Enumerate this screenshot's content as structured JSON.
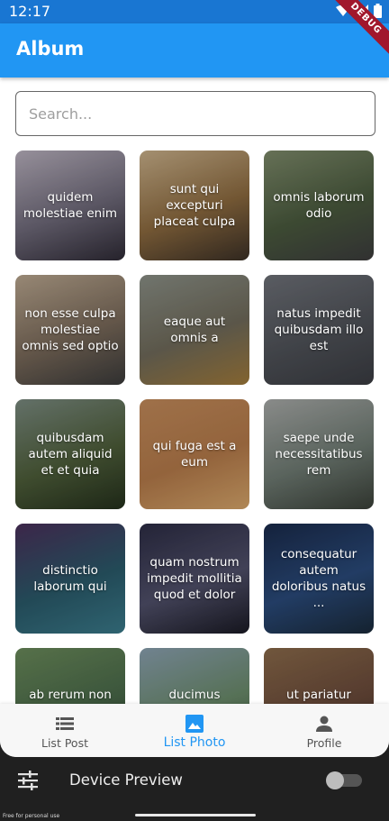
{
  "status_bar": {
    "time": "12:17",
    "wifi_icon": "wifi-icon",
    "battery_icon": "battery-icon"
  },
  "debug_banner": "DEBUG",
  "appbar": {
    "title": "Album"
  },
  "search": {
    "placeholder": "Search...",
    "value": ""
  },
  "photos": [
    {
      "title": "quidem molestiae enim",
      "colors": [
        "#b8b0bd",
        "#6f6a7a",
        "#2e2a35"
      ]
    },
    {
      "title": "sunt qui excepturi placeat culpa",
      "colors": [
        "#c9b08a",
        "#8c6a3f",
        "#3b3026"
      ]
    },
    {
      "title": "omnis laborum odio",
      "colors": [
        "#7d8a6a",
        "#4a5a3e",
        "#3c3c3c"
      ]
    },
    {
      "title": "non esse culpa molestiae omnis sed optio",
      "colors": [
        "#b9a68f",
        "#7a6a5a",
        "#3a3a3a"
      ]
    },
    {
      "title": "eaque aut omnis a",
      "colors": [
        "#8a8f86",
        "#6f6a5a",
        "#a07a3a"
      ]
    },
    {
      "title": "natus impedit quibusdam illo est",
      "colors": [
        "#6e7178",
        "#4f5258",
        "#3a3c42"
      ]
    },
    {
      "title": "quibusdam autem aliquid et et quia",
      "colors": [
        "#7a8a80",
        "#4e5e3a",
        "#24301c"
      ]
    },
    {
      "title": "qui fuga est a eum",
      "colors": [
        "#c28a5a",
        "#b47a4a",
        "#d6a56a"
      ]
    },
    {
      "title": "saepe unde necessitatibus rem",
      "colors": [
        "#a8aaa8",
        "#6e7a72",
        "#3a4038"
      ]
    },
    {
      "title": "distinctio laborum qui",
      "colors": [
        "#4a2f5a",
        "#2a5a6a",
        "#3a7a8a"
      ]
    },
    {
      "title": "quam nostrum impedit mollitia quod et dolor",
      "colors": [
        "#2c2c44",
        "#50506a",
        "#1a1a24"
      ]
    },
    {
      "title": "consequatur autem doloribus natus ...",
      "colors": [
        "#1a2a4a",
        "#2a4a7a",
        "#1a2a3a"
      ]
    },
    {
      "title": "ab rerum non rerum",
      "colors": [
        "#6a8a5a",
        "#4a6a4a",
        "#2a3a2a"
      ]
    },
    {
      "title": "ducimus molestias eos",
      "colors": [
        "#8aa0b0",
        "#6a8a6a",
        "#3a5a3a"
      ]
    },
    {
      "title": "ut pariatur rerum ipsum",
      "colors": [
        "#8a6a4a",
        "#6a4a3a",
        "#3a2a20"
      ]
    }
  ],
  "bottom_nav": [
    {
      "label": "List Post",
      "icon": "list-icon",
      "active": false
    },
    {
      "label": "List Photo",
      "icon": "image-icon",
      "active": true
    },
    {
      "label": "Profile",
      "icon": "person-icon",
      "active": false
    }
  ],
  "device_preview": {
    "label": "Device Preview",
    "icon": "tune-icon",
    "toggle_on": false
  },
  "watermark": "Free for personal use",
  "colors": {
    "primary": "#2196F3",
    "status_bar": "#1976D2",
    "active_nav": "#2196F3"
  }
}
